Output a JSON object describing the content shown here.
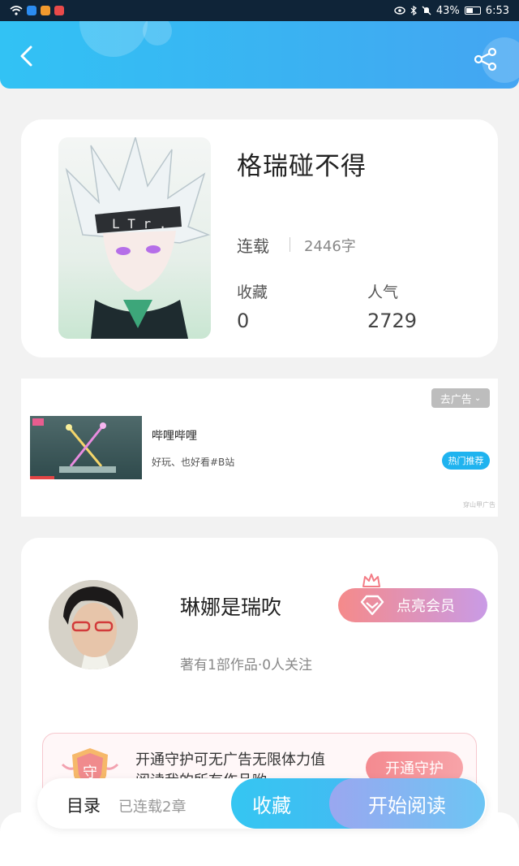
{
  "status_bar": {
    "battery": "43%",
    "time": "6:53"
  },
  "header": {
    "back_icon": "back-arrow-icon",
    "share_icon": "share-icon"
  },
  "book": {
    "title": "格瑞碰不得",
    "status": "连载",
    "word_count": "2446字",
    "favorites_label": "收藏",
    "favorites_value": "0",
    "popularity_label": "人气",
    "popularity_value": "2729"
  },
  "ad": {
    "remove_label": "去广告",
    "title": "哔哩哔哩",
    "description": "好玩、也好看#B站",
    "badge": "热门推荐",
    "source": "穿山甲广告"
  },
  "author": {
    "name": "琳娜是瑞吹",
    "meta": "著有1部作品·0人关注",
    "vip_label": "点亮会员",
    "guard_text": "开通守护可无广告无限体力值阅读我的所有作品哟~",
    "guard_icon_char": "守",
    "guard_button": "开通守护"
  },
  "bottom": {
    "toc_label": "目录",
    "toc_sub": "已连载2章",
    "favorite_label": "收藏",
    "read_label": "开始阅读"
  },
  "colors": {
    "header_start": "#32c2f4",
    "header_end": "#44a5f2",
    "accent_blue": "#1fb3ef",
    "vip_pink": "#f58a8a",
    "vip_purple": "#c99be6"
  }
}
